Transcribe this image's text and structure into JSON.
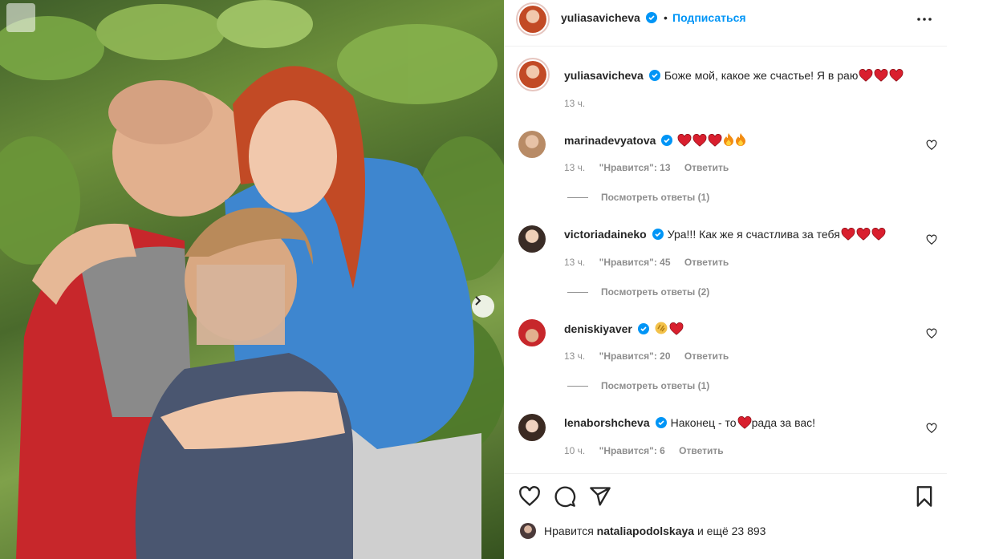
{
  "header": {
    "username": "yuliasavicheva",
    "separator": "•",
    "follow_label": "Подписаться"
  },
  "caption": {
    "username": "yuliasavicheva",
    "text": "Боже мой, какое же счастье! Я в раю",
    "emojis": [
      "heart",
      "heart",
      "heart"
    ],
    "time": "13 ч."
  },
  "comments": [
    {
      "username": "marinadevyatova",
      "text": "",
      "emojis": [
        "heart",
        "heart",
        "heart",
        "fire",
        "fire"
      ],
      "time": "13 ч.",
      "likes": "\"Нравится\": 13",
      "reply": "Ответить",
      "view_replies": "Посмотреть ответы (1)"
    },
    {
      "username": "victoriadaineko",
      "text": "Ура!!! Как же я счастлива за тебя",
      "emojis": [
        "heart",
        "heart",
        "heart"
      ],
      "time": "13 ч.",
      "likes": "\"Нравится\": 45",
      "reply": "Ответить",
      "view_replies": "Посмотреть ответы (2)"
    },
    {
      "username": "deniskiyaver",
      "text": "",
      "emojis": [
        "clap",
        "heart"
      ],
      "time": "13 ч.",
      "likes": "\"Нравится\": 20",
      "reply": "Ответить",
      "view_replies": "Посмотреть ответы (1)"
    },
    {
      "username": "lenaborshcheva",
      "text_before": "Наконец - то",
      "emojis": [
        "heart"
      ],
      "text_after": "рада за вас!",
      "time": "10 ч.",
      "likes": "\"Нравится\": 6",
      "reply": "Ответить"
    }
  ],
  "likes_summary": {
    "prefix": "Нравится",
    "user": "nataliapodolskaya",
    "suffix": "и ещё 23 893"
  },
  "colors": {
    "accent": "#0095f6",
    "heart": "#e0245e",
    "muted": "#8e8e8e",
    "text": "#262626"
  },
  "icons": [
    "heart-icon",
    "comment-icon",
    "share-icon",
    "bookmark-icon",
    "more-icon",
    "verified-icon",
    "next-arrow-icon",
    "multi-photo-icon"
  ]
}
